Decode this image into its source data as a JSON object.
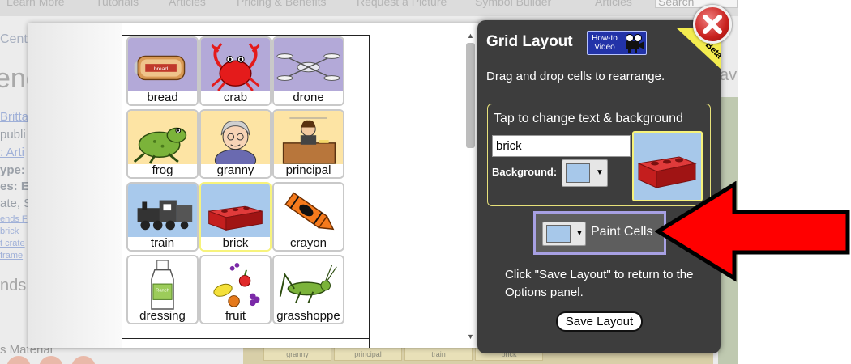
{
  "background_site": {
    "nav_items": [
      "Learn More",
      "Tutorials",
      "Articles",
      "Pricing & Benefits",
      "Request a Picture",
      "Symbol Builder",
      "Articles",
      "Search"
    ],
    "left_partial_text": "Cent",
    "big_partial_text": "end",
    "lines": [
      "Britta",
      "publi",
      ": Arti",
      "ype:",
      "es: E",
      "ate, S",
      "ends F",
      "brick",
      "t crate",
      "frame"
    ],
    "lower_partial_text": "nds",
    "material_text": "s Material",
    "strip_labels": [
      "granny",
      "principal",
      "train",
      "brick"
    ],
    "right_partial_text": "av"
  },
  "grid": {
    "cells": [
      {
        "label": "bread",
        "color": "purple",
        "icon": "bread-icon"
      },
      {
        "label": "crab",
        "color": "purple",
        "icon": "crab-icon"
      },
      {
        "label": "drone",
        "color": "purple",
        "icon": "drone-icon"
      },
      {
        "label": "frog",
        "color": "yellow",
        "icon": "frog-icon"
      },
      {
        "label": "granny",
        "color": "yellow",
        "icon": "granny-icon"
      },
      {
        "label": "principal",
        "color": "yellow",
        "icon": "principal-icon"
      },
      {
        "label": "train",
        "color": "blue",
        "icon": "train-icon"
      },
      {
        "label": "brick",
        "color": "blue",
        "icon": "brick-icon",
        "selected": true
      },
      {
        "label": "crayon",
        "color": "white",
        "icon": "crayon-icon"
      },
      {
        "label": "dressing",
        "color": "white",
        "icon": "dressing-icon"
      },
      {
        "label": "fruit",
        "color": "white",
        "icon": "fruit-icon"
      },
      {
        "label": "grasshoppe",
        "color": "white",
        "icon": "grasshopper-icon"
      }
    ],
    "bread_pic_text": "bread",
    "dressing_pic_text": "Ranch"
  },
  "panel": {
    "title": "Grid Layout",
    "howto_label": "How-to Video",
    "beta_label": "Beta",
    "instructions": "Drag and drop cells to rearrange.",
    "edit_box_title": "Tap to change text & background",
    "cell_text_value": "brick",
    "background_label": "Background:",
    "background_color": "#a7c8ea",
    "paint_cells_label": "Paint Cells",
    "save_instructions": "Click \"Save Layout\" to return to the Options panel.",
    "save_button_label": "Save Layout"
  },
  "colors": {
    "panel_bg": "#3d3d3d",
    "highlight_yellow": "#f6f27a",
    "paint_border": "#a7a0e3",
    "arrow_red": "#ff0000",
    "close_red": "#c8211d",
    "cell_purple": "#b3a9d8",
    "cell_yellow": "#fde4a4",
    "cell_blue": "#a8c9ec"
  }
}
